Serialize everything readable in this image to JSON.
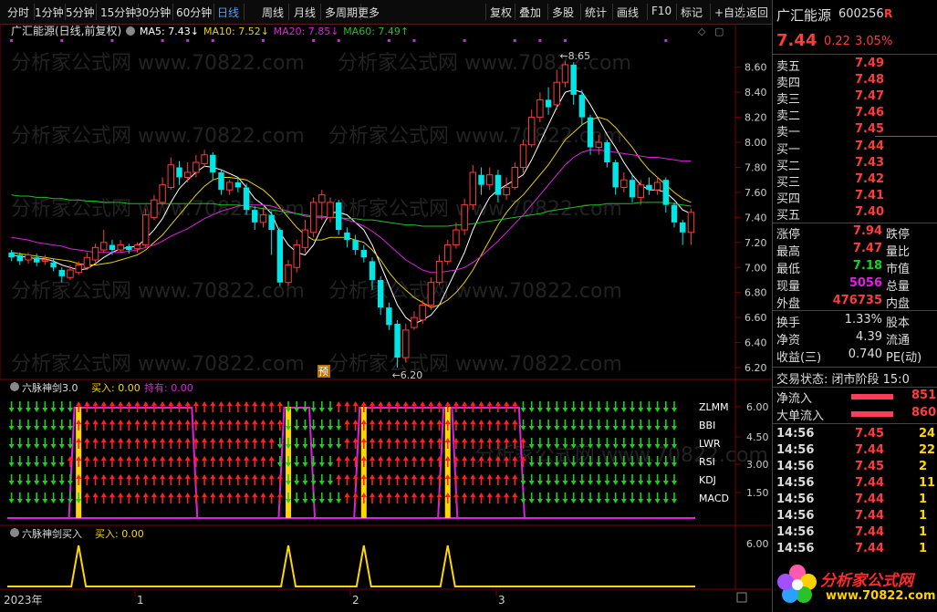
{
  "toolbar": {
    "periods": [
      "分时",
      "1分钟",
      "5分钟",
      "15分钟",
      "30分钟",
      "60分钟",
      "日线",
      "周线",
      "月线",
      "多周期",
      "更多"
    ],
    "more_arrow": "▸",
    "active_period": "日线",
    "tools": [
      "复权",
      "叠加",
      "多股",
      "统计",
      "画线",
      "F10",
      "标记",
      "+自选",
      "返回"
    ]
  },
  "main_chart": {
    "title": "广汇能源(日线,前复权)",
    "ma": [
      {
        "label": "MA5: 7.43",
        "arrow": "↓",
        "color": "#ffffff"
      },
      {
        "label": "MA10: 7.52",
        "arrow": "↓",
        "color": "#e8d000"
      },
      {
        "label": "MA20: 7.85",
        "arrow": "↓",
        "color": "#e020e0"
      },
      {
        "label": "MA60: 7.49",
        "arrow": "↑",
        "color": "#20c020"
      }
    ],
    "price_ticks": [
      "8.60",
      "8.40",
      "8.20",
      "8.00",
      "7.80",
      "7.60",
      "7.40",
      "7.20",
      "7.00",
      "6.80",
      "6.60",
      "6.40",
      "6.20"
    ],
    "high_marker": "8.65",
    "low_marker": "6.20",
    "pre_badge": "预",
    "watermark": "分析家公式网 www.70822.com"
  },
  "indicator1": {
    "title": "六脉神剑3.0",
    "buy_label": "买入: 0.00",
    "hold_label": "持有: 0.00",
    "row_labels": [
      "ZLMM",
      "BBI",
      "LWR",
      "RSI",
      "KDJ",
      "MACD"
    ],
    "ticks": [
      "6.00",
      "4.50",
      "3.00",
      "1.50"
    ]
  },
  "indicator2": {
    "title": "六脉神剑买入",
    "buy_label": "买入: 0.00",
    "ticks": [
      "6.00"
    ]
  },
  "xaxis": {
    "labels": [
      "2023年",
      "1",
      "2",
      "3"
    ]
  },
  "colors": {
    "up": "#ff3c3c",
    "down": "#00e5e5",
    "bg": "#000000",
    "grid": "#3a0000"
  },
  "quote": {
    "name": "广汇能源",
    "code": "600256",
    "badge": "R",
    "price": "7.44",
    "change": "0.22",
    "pct": "3.05%",
    "asks": [
      {
        "label": "卖五",
        "price": "7.49"
      },
      {
        "label": "卖四",
        "price": "7.48"
      },
      {
        "label": "卖三",
        "price": "7.47"
      },
      {
        "label": "卖二",
        "price": "7.46"
      },
      {
        "label": "卖一",
        "price": "7.45"
      }
    ],
    "bids": [
      {
        "label": "买一",
        "price": "7.44"
      },
      {
        "label": "买二",
        "price": "7.43"
      },
      {
        "label": "买三",
        "price": "7.42"
      },
      {
        "label": "买四",
        "price": "7.41"
      },
      {
        "label": "买五",
        "price": "7.40"
      }
    ],
    "stats": [
      {
        "l": "涨停",
        "v": "7.94",
        "vc": "red",
        "r": "跌停"
      },
      {
        "l": "最高",
        "v": "7.47",
        "vc": "red",
        "r": "量比"
      },
      {
        "l": "最低",
        "v": "7.18",
        "vc": "green",
        "r": "市值"
      },
      {
        "l": "现量",
        "v": "5056",
        "vc": "purple",
        "r": "总量"
      },
      {
        "l": "外盘",
        "v": "476735",
        "vc": "red",
        "r": "内盘"
      }
    ],
    "stats2": [
      {
        "l": "换手",
        "v": "1.33%",
        "r": "股本"
      },
      {
        "l": "净资",
        "v": "4.39",
        "r": "流通"
      },
      {
        "l": "收益(三)",
        "v": "0.740",
        "r": "PE(动)"
      }
    ],
    "trade_status": "交易状态: 闭市阶段 15:0",
    "netflow": [
      {
        "l": "净流入",
        "v": "851"
      },
      {
        "l": "大单流入",
        "v": "860"
      }
    ],
    "ticks": [
      {
        "t": "14:56",
        "p": "7.45",
        "v": "24"
      },
      {
        "t": "14:56",
        "p": "7.44",
        "v": "22"
      },
      {
        "t": "14:56",
        "p": "7.45",
        "v": "2"
      },
      {
        "t": "14:56",
        "p": "7.44",
        "v": "11"
      },
      {
        "t": "14:56",
        "p": "7.44",
        "v": "1"
      },
      {
        "t": "14:56",
        "p": "7.44",
        "v": "1"
      },
      {
        "t": "14:56",
        "p": "7.44",
        "v": "1"
      },
      {
        "t": "14:56",
        "p": "7.44",
        "v": "1"
      }
    ],
    "logo_text": "分析家公式网",
    "logo_url": "www.70822.com"
  },
  "chart_data": {
    "type": "candlestick",
    "y_range": [
      6.12,
      8.7
    ],
    "candles": [
      [
        7.12,
        7.08,
        7.14,
        7.05
      ],
      [
        7.1,
        7.05,
        7.12,
        7.02
      ],
      [
        7.06,
        7.1,
        7.12,
        7.03
      ],
      [
        7.08,
        7.04,
        7.11,
        7.01
      ],
      [
        7.05,
        7.06,
        7.1,
        7.02
      ],
      [
        7.04,
        7.0,
        7.07,
        6.97
      ],
      [
        6.98,
        6.93,
        7.0,
        6.88
      ],
      [
        6.92,
        6.98,
        7.02,
        6.9
      ],
      [
        6.96,
        7.02,
        7.05,
        6.94
      ],
      [
        7.0,
        7.08,
        7.12,
        6.98
      ],
      [
        7.06,
        7.16,
        7.19,
        7.04
      ],
      [
        7.14,
        7.2,
        7.3,
        7.12
      ],
      [
        7.18,
        7.14,
        7.22,
        7.1
      ],
      [
        7.14,
        7.18,
        7.22,
        7.12
      ],
      [
        7.17,
        7.14,
        7.19,
        7.11
      ],
      [
        7.15,
        7.18,
        7.2,
        7.12
      ],
      [
        7.18,
        7.42,
        7.47,
        7.16
      ],
      [
        7.4,
        7.54,
        7.58,
        7.38
      ],
      [
        7.52,
        7.66,
        7.72,
        7.5
      ],
      [
        7.64,
        7.82,
        7.88,
        7.62
      ],
      [
        7.8,
        7.72,
        7.85,
        7.66
      ],
      [
        7.72,
        7.76,
        7.84,
        7.68
      ],
      [
        7.76,
        7.84,
        7.9,
        7.72
      ],
      [
        7.83,
        7.9,
        7.94,
        7.8
      ],
      [
        7.9,
        7.76,
        7.92,
        7.7
      ],
      [
        7.76,
        7.62,
        7.78,
        7.58
      ],
      [
        7.62,
        7.68,
        7.7,
        7.58
      ],
      [
        7.68,
        7.64,
        7.72,
        7.6
      ],
      [
        7.64,
        7.46,
        7.67,
        7.42
      ],
      [
        7.46,
        7.36,
        7.49,
        7.3
      ],
      [
        7.36,
        7.42,
        7.48,
        7.32
      ],
      [
        7.42,
        7.3,
        7.45,
        7.1
      ],
      [
        7.3,
        6.88,
        7.32,
        6.85
      ],
      [
        6.88,
        7.02,
        7.06,
        6.85
      ],
      [
        7.0,
        7.18,
        7.22,
        6.96
      ],
      [
        7.16,
        7.3,
        7.38,
        7.12
      ],
      [
        7.28,
        7.52,
        7.56,
        7.24
      ],
      [
        7.52,
        7.58,
        7.62,
        7.38
      ],
      [
        7.4,
        7.52,
        7.56,
        7.36
      ],
      [
        7.52,
        7.3,
        7.54,
        7.26
      ],
      [
        7.28,
        7.22,
        7.32,
        7.16
      ],
      [
        7.22,
        7.14,
        7.26,
        7.1
      ],
      [
        7.14,
        7.08,
        7.18,
        7.04
      ],
      [
        7.05,
        6.9,
        7.08,
        6.82
      ],
      [
        6.9,
        6.68,
        6.93,
        6.62
      ],
      [
        6.68,
        6.54,
        6.72,
        6.5
      ],
      [
        6.55,
        6.28,
        6.58,
        6.2
      ],
      [
        6.28,
        6.5,
        6.55,
        6.24
      ],
      [
        6.52,
        6.6,
        6.65,
        6.5
      ],
      [
        6.58,
        6.7,
        6.74,
        6.55
      ],
      [
        6.7,
        6.88,
        6.92,
        6.66
      ],
      [
        6.88,
        7.05,
        7.1,
        6.86
      ],
      [
        7.05,
        7.18,
        7.22,
        7.02
      ],
      [
        7.18,
        7.3,
        7.36,
        7.15
      ],
      [
        7.3,
        7.5,
        7.55,
        7.26
      ],
      [
        7.5,
        7.76,
        7.82,
        7.46
      ],
      [
        7.74,
        7.66,
        7.8,
        7.58
      ],
      [
        7.66,
        7.74,
        7.8,
        7.62
      ],
      [
        7.74,
        7.58,
        7.78,
        7.52
      ],
      [
        7.58,
        7.64,
        7.72,
        7.54
      ],
      [
        7.64,
        7.8,
        7.84,
        7.62
      ],
      [
        7.8,
        7.98,
        8.02,
        7.76
      ],
      [
        7.98,
        8.2,
        8.26,
        7.96
      ],
      [
        8.2,
        8.34,
        8.4,
        8.16
      ],
      [
        8.34,
        8.28,
        8.44,
        8.22
      ],
      [
        8.3,
        8.48,
        8.58,
        8.26
      ],
      [
        8.48,
        8.62,
        8.65,
        8.44
      ],
      [
        8.62,
        8.38,
        8.64,
        8.3
      ],
      [
        8.38,
        8.2,
        8.42,
        8.14
      ],
      [
        8.2,
        7.96,
        8.22,
        7.9
      ],
      [
        7.96,
        8.0,
        8.06,
        7.9
      ],
      [
        8.0,
        7.84,
        8.02,
        7.8
      ],
      [
        7.84,
        7.64,
        7.86,
        7.58
      ],
      [
        7.64,
        7.7,
        7.76,
        7.6
      ],
      [
        7.7,
        7.56,
        7.74,
        7.52
      ],
      [
        7.56,
        7.66,
        7.7,
        7.5
      ],
      [
        7.66,
        7.62,
        7.72,
        7.58
      ],
      [
        7.62,
        7.68,
        7.72,
        7.58
      ],
      [
        7.7,
        7.5,
        7.72,
        7.44
      ],
      [
        7.5,
        7.36,
        7.52,
        7.32
      ],
      [
        7.36,
        7.28,
        7.38,
        7.18
      ],
      [
        7.28,
        7.44,
        7.47,
        7.18
      ]
    ],
    "ma_series": [
      {
        "name": "MA5",
        "color": "#ffffff",
        "values": [
          7.1,
          7.09,
          7.08,
          7.07,
          7.07,
          7.05,
          7.02,
          7.0,
          6.98,
          6.99,
          7.03,
          7.08,
          7.12,
          7.15,
          7.16,
          7.17,
          7.23,
          7.3,
          7.39,
          7.52,
          7.63,
          7.7,
          7.76,
          7.81,
          7.8,
          7.78,
          7.75,
          7.72,
          7.64,
          7.55,
          7.5,
          7.43,
          7.28,
          7.18,
          7.12,
          7.1,
          7.18,
          7.32,
          7.44,
          7.44,
          7.42,
          7.36,
          7.3,
          7.18,
          7.02,
          6.86,
          6.7,
          6.6,
          6.55,
          6.58,
          6.62,
          6.7,
          6.84,
          6.98,
          7.12,
          7.3,
          7.44,
          7.56,
          7.62,
          7.66,
          7.7,
          7.74,
          7.86,
          8.0,
          8.14,
          8.28,
          8.4,
          8.42,
          8.4,
          8.3,
          8.18,
          8.06,
          7.96,
          7.84,
          7.74,
          7.66,
          7.62,
          7.62,
          7.6,
          7.54,
          7.46,
          7.43
        ]
      },
      {
        "name": "MA10",
        "color": "#e8d000",
        "values": [
          7.12,
          7.11,
          7.1,
          7.09,
          7.08,
          7.07,
          7.06,
          7.05,
          7.03,
          7.02,
          7.02,
          7.03,
          7.04,
          7.06,
          7.08,
          7.1,
          7.14,
          7.2,
          7.26,
          7.34,
          7.42,
          7.5,
          7.58,
          7.65,
          7.7,
          7.72,
          7.72,
          7.71,
          7.7,
          7.66,
          7.62,
          7.56,
          7.48,
          7.4,
          7.32,
          7.26,
          7.22,
          7.22,
          7.24,
          7.24,
          7.24,
          7.22,
          7.2,
          7.14,
          7.06,
          6.96,
          6.88,
          6.82,
          6.76,
          6.72,
          6.68,
          6.7,
          6.74,
          6.8,
          6.88,
          6.98,
          7.1,
          7.22,
          7.34,
          7.44,
          7.52,
          7.58,
          7.66,
          7.74,
          7.82,
          7.92,
          8.02,
          8.08,
          8.14,
          8.18,
          8.2,
          8.18,
          8.12,
          8.04,
          7.96,
          7.86,
          7.78,
          7.72,
          7.66,
          7.6,
          7.55,
          7.52
        ]
      },
      {
        "name": "MA20",
        "color": "#e020e0",
        "values": [
          7.24,
          7.23,
          7.22,
          7.2,
          7.19,
          7.18,
          7.17,
          7.15,
          7.14,
          7.13,
          7.12,
          7.12,
          7.12,
          7.12,
          7.13,
          7.14,
          7.16,
          7.18,
          7.21,
          7.25,
          7.28,
          7.31,
          7.35,
          7.39,
          7.42,
          7.45,
          7.47,
          7.49,
          7.5,
          7.5,
          7.5,
          7.49,
          7.47,
          7.45,
          7.43,
          7.41,
          7.4,
          7.4,
          7.4,
          7.4,
          7.38,
          7.36,
          7.33,
          7.29,
          7.24,
          7.18,
          7.12,
          7.06,
          7.02,
          6.98,
          6.96,
          6.96,
          6.97,
          6.98,
          7.0,
          7.04,
          7.09,
          7.15,
          7.21,
          7.28,
          7.35,
          7.42,
          7.5,
          7.58,
          7.66,
          7.74,
          7.82,
          7.88,
          7.92,
          7.94,
          7.94,
          7.93,
          7.92,
          7.91,
          7.9,
          7.89,
          7.88,
          7.88,
          7.87,
          7.86,
          7.85,
          7.85
        ]
      },
      {
        "name": "MA60",
        "color": "#20c020",
        "values": [
          7.58,
          7.57,
          7.57,
          7.56,
          7.56,
          7.55,
          7.55,
          7.54,
          7.54,
          7.53,
          7.53,
          7.52,
          7.52,
          7.52,
          7.51,
          7.51,
          7.51,
          7.51,
          7.51,
          7.51,
          7.51,
          7.51,
          7.51,
          7.51,
          7.51,
          7.5,
          7.5,
          7.5,
          7.49,
          7.48,
          7.47,
          7.46,
          7.45,
          7.44,
          7.43,
          7.42,
          7.41,
          7.41,
          7.4,
          7.4,
          7.39,
          7.39,
          7.38,
          7.38,
          7.37,
          7.36,
          7.35,
          7.34,
          7.34,
          7.33,
          7.33,
          7.33,
          7.33,
          7.34,
          7.34,
          7.35,
          7.36,
          7.37,
          7.38,
          7.39,
          7.4,
          7.41,
          7.42,
          7.43,
          7.45,
          7.46,
          7.47,
          7.48,
          7.49,
          7.5,
          7.5,
          7.51,
          7.51,
          7.51,
          7.51,
          7.52,
          7.52,
          7.52,
          7.52,
          7.51,
          7.5,
          7.49
        ]
      }
    ],
    "indicator1_signals": [
      "DDDDDDDDUUUUUUUUUUUUUUUUUUUUUUUUUDDDDDDUUUUUUUUUUUUUUUUUUUUUUDDDDDDDDDDDDDDDDDDD",
      "DDDDDDDDUUUUUUUUUUUUUUUUUUUUUUUUUDDDDDDDUUUUUUUUUUUUUUUUUUUUUDDDDDDDDDDDDDDDDDDD",
      "DDDDDDDDUUUUUUUUUUUUUUUUUUUUUUUUDDDDDDDDUUUUUUUUUUUUUUUUUUUUUUDDDDDDDDDDDDDDDDDD",
      "DDDDDDDUUUUUUUUUUUUUUUUUUUUUUUUUDDDDDDDUUUUUUUUUUUUUUUUUUUUUUUDDDDDDDDDDDDDDDDDD",
      "DDDDDDDDUUUUUUUUUUUUUUUUUUUUUUUUUDDDDDDUUUUUUUUUUUUUUUUUUUUUUDDDDDDDDDDDDDDDDDDD",
      "DDDDDDDDDUUUUUUUUUUUUUUUUUUUUUUUUDDDDDDDUUUUUUUUUUUUUUUUUUUUUDDDDDDDDDDDDDDDDDDD"
    ],
    "buy_bars": [
      8,
      33,
      42,
      52
    ],
    "hold_ranges": [
      [
        8,
        21
      ],
      [
        33,
        35
      ],
      [
        42,
        52
      ],
      [
        52,
        60
      ]
    ],
    "buy_peaks": [
      8,
      33,
      42,
      52
    ]
  }
}
